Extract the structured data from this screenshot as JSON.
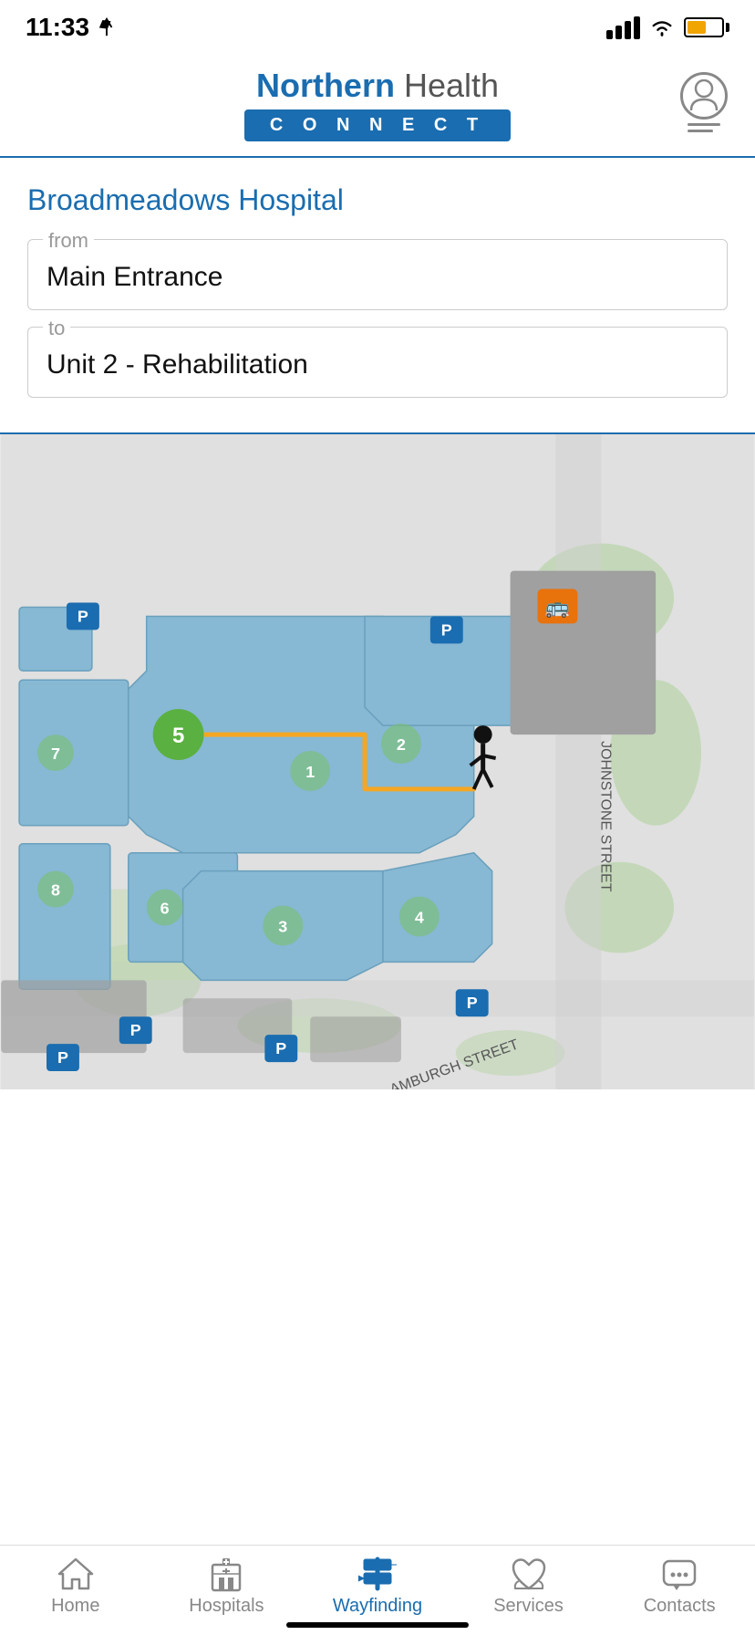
{
  "statusBar": {
    "time": "11:33",
    "locationIcon": true
  },
  "header": {
    "logoNorthern": "Northern",
    "logoHealth": " Health",
    "logoConnect": "C O N N E C T"
  },
  "page": {
    "hospitalName": "Broadmeadows Hospital",
    "fromLabel": "from",
    "fromValue": "Main Entrance",
    "toLabel": "to",
    "toValue": "Unit 2 - Rehabilitation"
  },
  "map": {
    "routeLabel": "5",
    "streetLabel1": "JOHNSTONE STREET",
    "streetLabel2": "AMBURGH STREET"
  },
  "bottomNav": {
    "items": [
      {
        "id": "home",
        "label": "Home",
        "active": false
      },
      {
        "id": "hospitals",
        "label": "Hospitals",
        "active": false
      },
      {
        "id": "wayfinding",
        "label": "Wayfinding",
        "active": true
      },
      {
        "id": "services",
        "label": "Services",
        "active": false
      },
      {
        "id": "contacts",
        "label": "Contacts",
        "active": false
      }
    ]
  }
}
